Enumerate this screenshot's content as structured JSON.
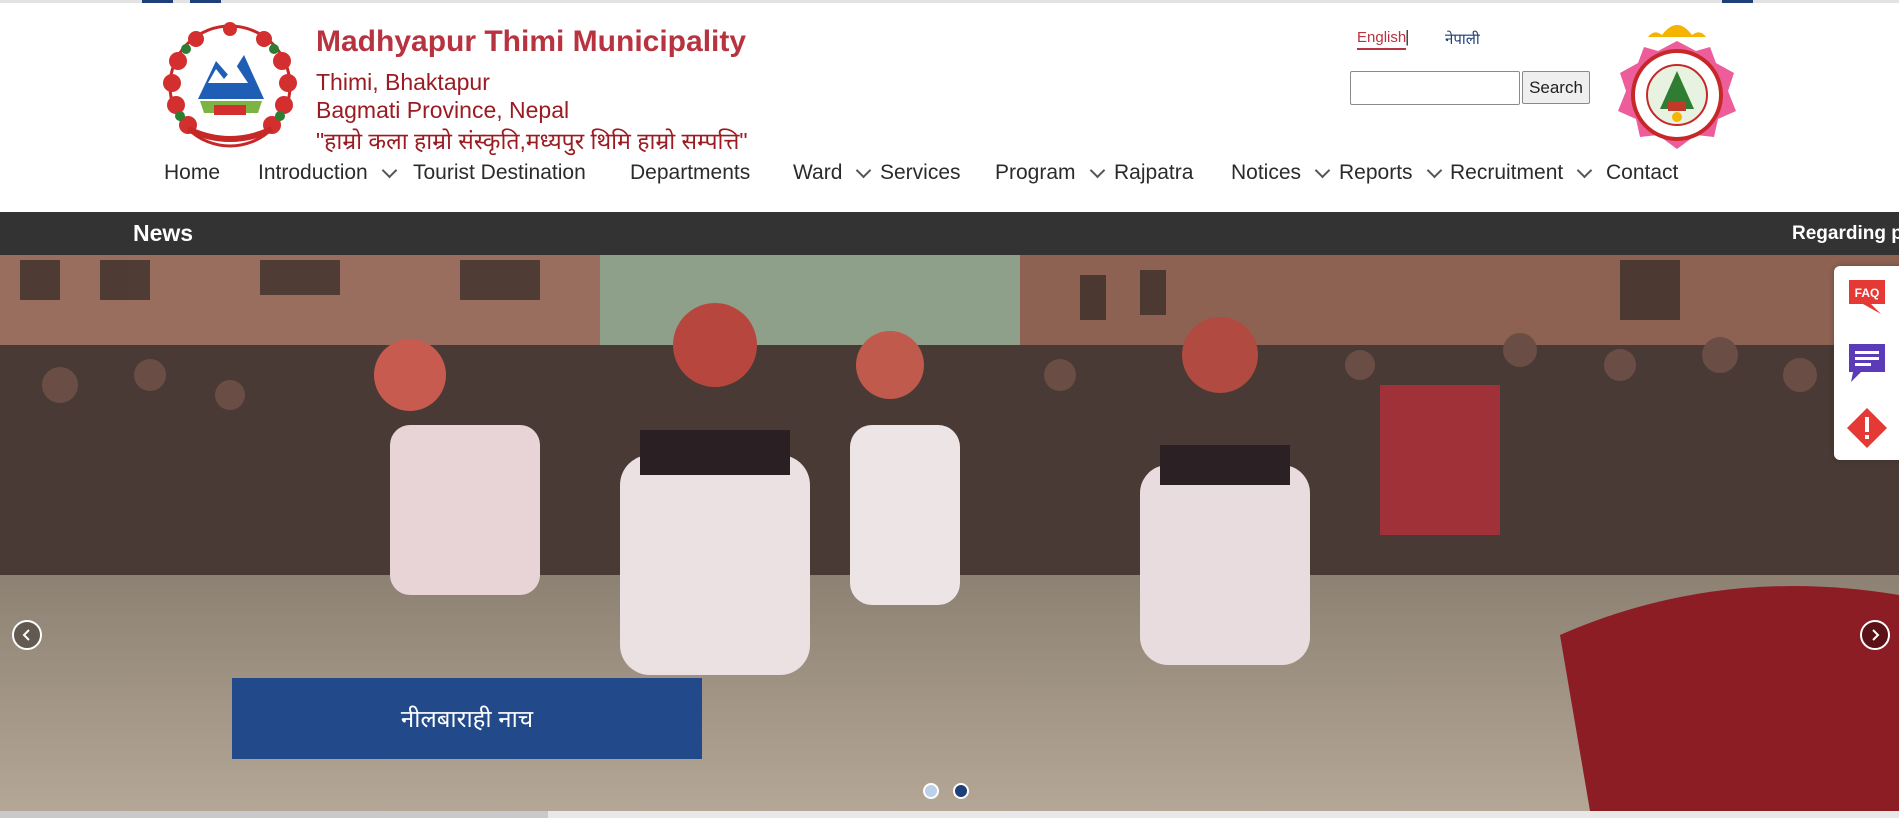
{
  "header": {
    "title": "Madhyapur Thimi Municipality",
    "address_line1": "Thimi, Bhaktapur",
    "address_line2": "Bagmati Province, Nepal",
    "motto": "\"हाम्रो कला हाम्रो संस्कृति,मध्यपुर थिमि हाम्रो सम्पत्ति\""
  },
  "language": {
    "english": "English",
    "separator": "|",
    "nepali": "नेपाली"
  },
  "search": {
    "button_label": "Search",
    "value": ""
  },
  "nav": {
    "items": [
      {
        "label": "Home",
        "has_dropdown": false
      },
      {
        "label": "Introduction",
        "has_dropdown": true
      },
      {
        "label": "Tourist Destination",
        "has_dropdown": false
      },
      {
        "label": "Departments",
        "has_dropdown": false
      },
      {
        "label": "Ward",
        "has_dropdown": true
      },
      {
        "label": "Services",
        "has_dropdown": false
      },
      {
        "label": "Program",
        "has_dropdown": true
      },
      {
        "label": "Rajpatra",
        "has_dropdown": false
      },
      {
        "label": "Notices",
        "has_dropdown": true
      },
      {
        "label": "Reports",
        "has_dropdown": true
      },
      {
        "label": "Recruitment",
        "has_dropdown": true
      },
      {
        "label": "Contact",
        "has_dropdown": false
      }
    ]
  },
  "news": {
    "label": "News",
    "ticker": "Regarding pu"
  },
  "slider": {
    "caption": "नीलबाराही नाच",
    "total_slides": 2,
    "active_slide": 2
  },
  "side_panel": {
    "items": [
      {
        "icon": "faq-icon",
        "label": "FAQ"
      },
      {
        "icon": "feedback-icon"
      },
      {
        "icon": "alert-icon"
      }
    ]
  },
  "colors": {
    "brand_red": "#b83340",
    "nav_dark": "#333333",
    "caption_blue": "#224a8b",
    "side_red": "#e53935",
    "side_purple": "#5c3bb8"
  }
}
